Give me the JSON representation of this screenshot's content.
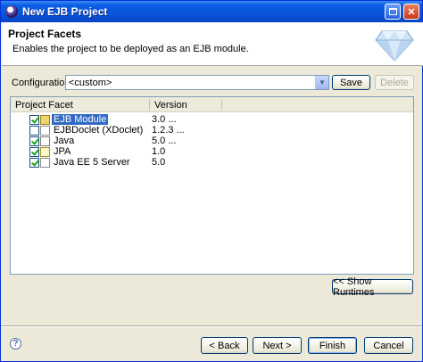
{
  "window": {
    "title": "New EJB Project"
  },
  "banner": {
    "title": "Project Facets",
    "description": "Enables the project to be deployed as an EJB module."
  },
  "configurations": {
    "label": "Configurations:",
    "value": "<custom>",
    "save_label": "Save",
    "delete_label": "Delete"
  },
  "table": {
    "headers": [
      "Project Facet",
      "Version"
    ],
    "rows": [
      {
        "name": "EJB Module",
        "version": "3.0 ...",
        "checked": true,
        "selected": true,
        "icon": "ejb-module-icon"
      },
      {
        "name": "EJBDoclet (XDoclet)",
        "version": "1.2.3 ...",
        "checked": false,
        "selected": false,
        "icon": "ejbdoclet-icon"
      },
      {
        "name": "Java",
        "version": "5.0 ...",
        "checked": true,
        "selected": false,
        "icon": "java-icon"
      },
      {
        "name": "JPA",
        "version": "1.0",
        "checked": true,
        "selected": false,
        "icon": "jpa-icon"
      },
      {
        "name": "Java EE 5 Server",
        "version": "5.0",
        "checked": true,
        "selected": false,
        "icon": "server-runtime-icon"
      }
    ]
  },
  "buttons": {
    "show_runtimes": "<< Show Runtimes",
    "back": "< Back",
    "next": "Next >",
    "finish": "Finish",
    "cancel": "Cancel"
  },
  "help": {
    "glyph": "?"
  },
  "colors": {
    "titlebar": "#0a55d8",
    "selection": "#316ac5",
    "dialog": "#ece9d8"
  }
}
